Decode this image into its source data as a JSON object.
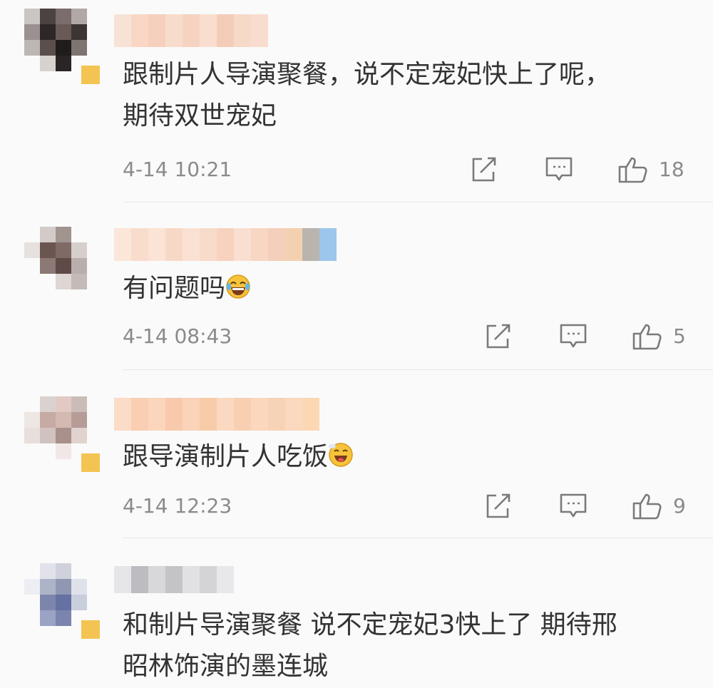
{
  "comments": [
    {
      "text": "跟制片人导演聚餐，说不定宠妃快上了呢，\n期待双世宠妃",
      "time": "4-14 10:21",
      "likes": "18",
      "emoji": ""
    },
    {
      "text": "有问题吗",
      "time": "4-14 08:43",
      "likes": "5",
      "emoji": "laughing-tears-emoji"
    },
    {
      "text": "跟导演制片人吃饭",
      "time": "4-14 12:23",
      "likes": "9",
      "emoji": "drooling-emoji"
    },
    {
      "text": "和制片导演聚餐 说不定宠妃3快上了 期待邢\n昭林饰演的墨连城",
      "time": "",
      "likes": "",
      "emoji": ""
    }
  ],
  "icons": {
    "share": "share-icon",
    "reply": "comment-icon",
    "like": "thumbs-up-icon"
  },
  "colors": {
    "time": "#8a8a8a",
    "text": "#333333",
    "icon": "#7a7a7a",
    "divider": "#e8e8e8"
  }
}
